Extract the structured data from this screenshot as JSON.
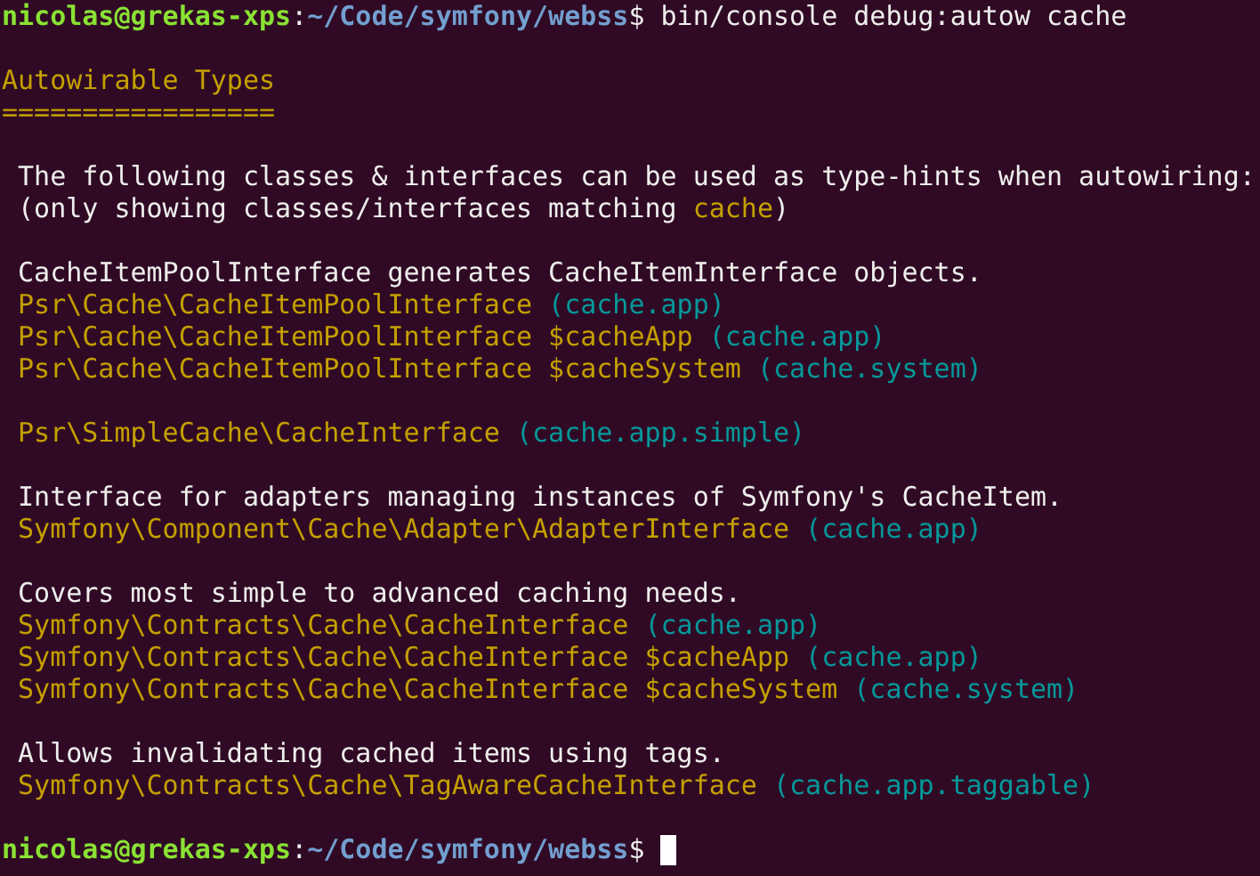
{
  "terminal": {
    "blocks": [
      [
        {
          "segments": [
            {
              "kind": "user",
              "text": "nicolas@grekas-xps"
            },
            {
              "kind": "plain",
              "text": ":"
            },
            {
              "kind": "cwd",
              "text": "~/Code/symfony/webss"
            },
            {
              "kind": "plain",
              "text": "$ bin/console debug:autow cache"
            }
          ]
        }
      ],
      [
        {
          "segments": [
            {
              "kind": "heading",
              "text": "Autowirable Types"
            }
          ]
        },
        {
          "segments": [
            {
              "kind": "heading",
              "text": "================="
            }
          ]
        }
      ],
      [
        {
          "segments": [
            {
              "kind": "plain",
              "text": " The following classes & interfaces can be used as type-hints when autowiring:"
            }
          ]
        },
        {
          "segments": [
            {
              "kind": "plain",
              "text": " (only showing classes/interfaces matching "
            },
            {
              "kind": "type",
              "text": "cache"
            },
            {
              "kind": "plain",
              "text": ")"
            }
          ]
        }
      ],
      [
        {
          "segments": [
            {
              "kind": "plain",
              "text": " CacheItemPoolInterface generates CacheItemInterface objects."
            }
          ]
        },
        {
          "segments": [
            {
              "kind": "type",
              "text": " Psr\\Cache\\CacheItemPoolInterface"
            },
            {
              "kind": "service",
              "text": " (cache.app)"
            }
          ]
        },
        {
          "segments": [
            {
              "kind": "type",
              "text": " Psr\\Cache\\CacheItemPoolInterface $cacheApp"
            },
            {
              "kind": "service",
              "text": " (cache.app)"
            }
          ]
        },
        {
          "segments": [
            {
              "kind": "type",
              "text": " Psr\\Cache\\CacheItemPoolInterface $cacheSystem"
            },
            {
              "kind": "service",
              "text": " (cache.system)"
            }
          ]
        }
      ],
      [
        {
          "segments": [
            {
              "kind": "type",
              "text": " Psr\\SimpleCache\\CacheInterface"
            },
            {
              "kind": "service",
              "text": " (cache.app.simple)"
            }
          ]
        }
      ],
      [
        {
          "segments": [
            {
              "kind": "plain",
              "text": " Interface for adapters managing instances of Symfony's CacheItem."
            }
          ]
        },
        {
          "segments": [
            {
              "kind": "type",
              "text": " Symfony\\Component\\Cache\\Adapter\\AdapterInterface"
            },
            {
              "kind": "service",
              "text": " (cache.app)"
            }
          ]
        }
      ],
      [
        {
          "segments": [
            {
              "kind": "plain",
              "text": " Covers most simple to advanced caching needs."
            }
          ]
        },
        {
          "segments": [
            {
              "kind": "type",
              "text": " Symfony\\Contracts\\Cache\\CacheInterface"
            },
            {
              "kind": "service",
              "text": " (cache.app)"
            }
          ]
        },
        {
          "segments": [
            {
              "kind": "type",
              "text": " Symfony\\Contracts\\Cache\\CacheInterface $cacheApp"
            },
            {
              "kind": "service",
              "text": " (cache.app)"
            }
          ]
        },
        {
          "segments": [
            {
              "kind": "type",
              "text": " Symfony\\Contracts\\Cache\\CacheInterface $cacheSystem"
            },
            {
              "kind": "service",
              "text": " (cache.system)"
            }
          ]
        }
      ],
      [
        {
          "segments": [
            {
              "kind": "plain",
              "text": " Allows invalidating cached items using tags."
            }
          ]
        },
        {
          "segments": [
            {
              "kind": "type",
              "text": " Symfony\\Contracts\\Cache\\TagAwareCacheInterface"
            },
            {
              "kind": "service",
              "text": " (cache.app.taggable)"
            }
          ]
        }
      ],
      [
        {
          "cursor": true,
          "segments": [
            {
              "kind": "user",
              "text": "nicolas@grekas-xps"
            },
            {
              "kind": "plain",
              "text": ":"
            },
            {
              "kind": "cwd",
              "text": "~/Code/symfony/webss"
            },
            {
              "kind": "plain",
              "text": "$ "
            }
          ]
        }
      ]
    ]
  }
}
